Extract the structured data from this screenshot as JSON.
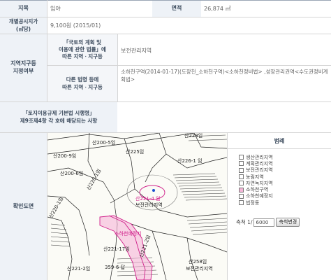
{
  "rows": {
    "jimok": {
      "label": "지목",
      "value": "임야"
    },
    "area": {
      "label": "면적",
      "value": "26,874 ㎡"
    },
    "price": {
      "label": "개별공시지가\n(㎡당)",
      "value": "9,100원 (2015/01)"
    },
    "zoning": {
      "label": "지역지구등\n지정여부",
      "national": {
        "label": "「국토의 계획 및\n이용에 관한 법률」에\n따른 지역ㆍ지구등",
        "value": "보전관리지역"
      },
      "other": {
        "label": "다른 법령 등에\n따른 지역ㆍ지구등",
        "value": "소하천구역(2014-01-17)(도장천_소하천구역)<소하천정비법> ,성장관리권역<수도권정비계획법>"
      }
    },
    "article9": {
      "label": "「토지이용규제 기본법 시행령」\n제9조제4항 각 호에 해당되는 사항",
      "value": ""
    },
    "map": {
      "label": "확인도면"
    }
  },
  "legend": {
    "title": "범례",
    "items": [
      {
        "label": "생산관리지역",
        "color": "#ffffff"
      },
      {
        "label": "계획관리지역",
        "color": "#ffffff"
      },
      {
        "label": "보전관리지역",
        "color": "#ffffff"
      },
      {
        "label": "농림지역",
        "color": "#ffffff"
      },
      {
        "label": "자연녹지지역",
        "color": "#ffffff"
      },
      {
        "label": "소하천구역",
        "color": "#f6b6d8"
      },
      {
        "label": "소하천예정지",
        "color": "#ffffff"
      },
      {
        "label": "법정동",
        "color": "#ffffff"
      }
    ],
    "scale_prefix": "축척 1/",
    "scale_value": "6000",
    "scale_button": "축척변경"
  },
  "map_labels": {
    "l1": "산228일",
    "l2": "산200-5임",
    "l3": "산200-9임",
    "l4": "산225임",
    "l5": "산226-1 임",
    "l6": "산221-4 임",
    "l7": "보전관리지역",
    "l8": "산200-6임",
    "l9": "산220-1임",
    "l10": "산220-1임",
    "l11": "산221-17임",
    "l12": "산221-2임",
    "l13": "359-6 답",
    "l14": "산258임",
    "l15": "산221-2임",
    "l16": "소하천예정지",
    "l17": "보전관리지역"
  }
}
